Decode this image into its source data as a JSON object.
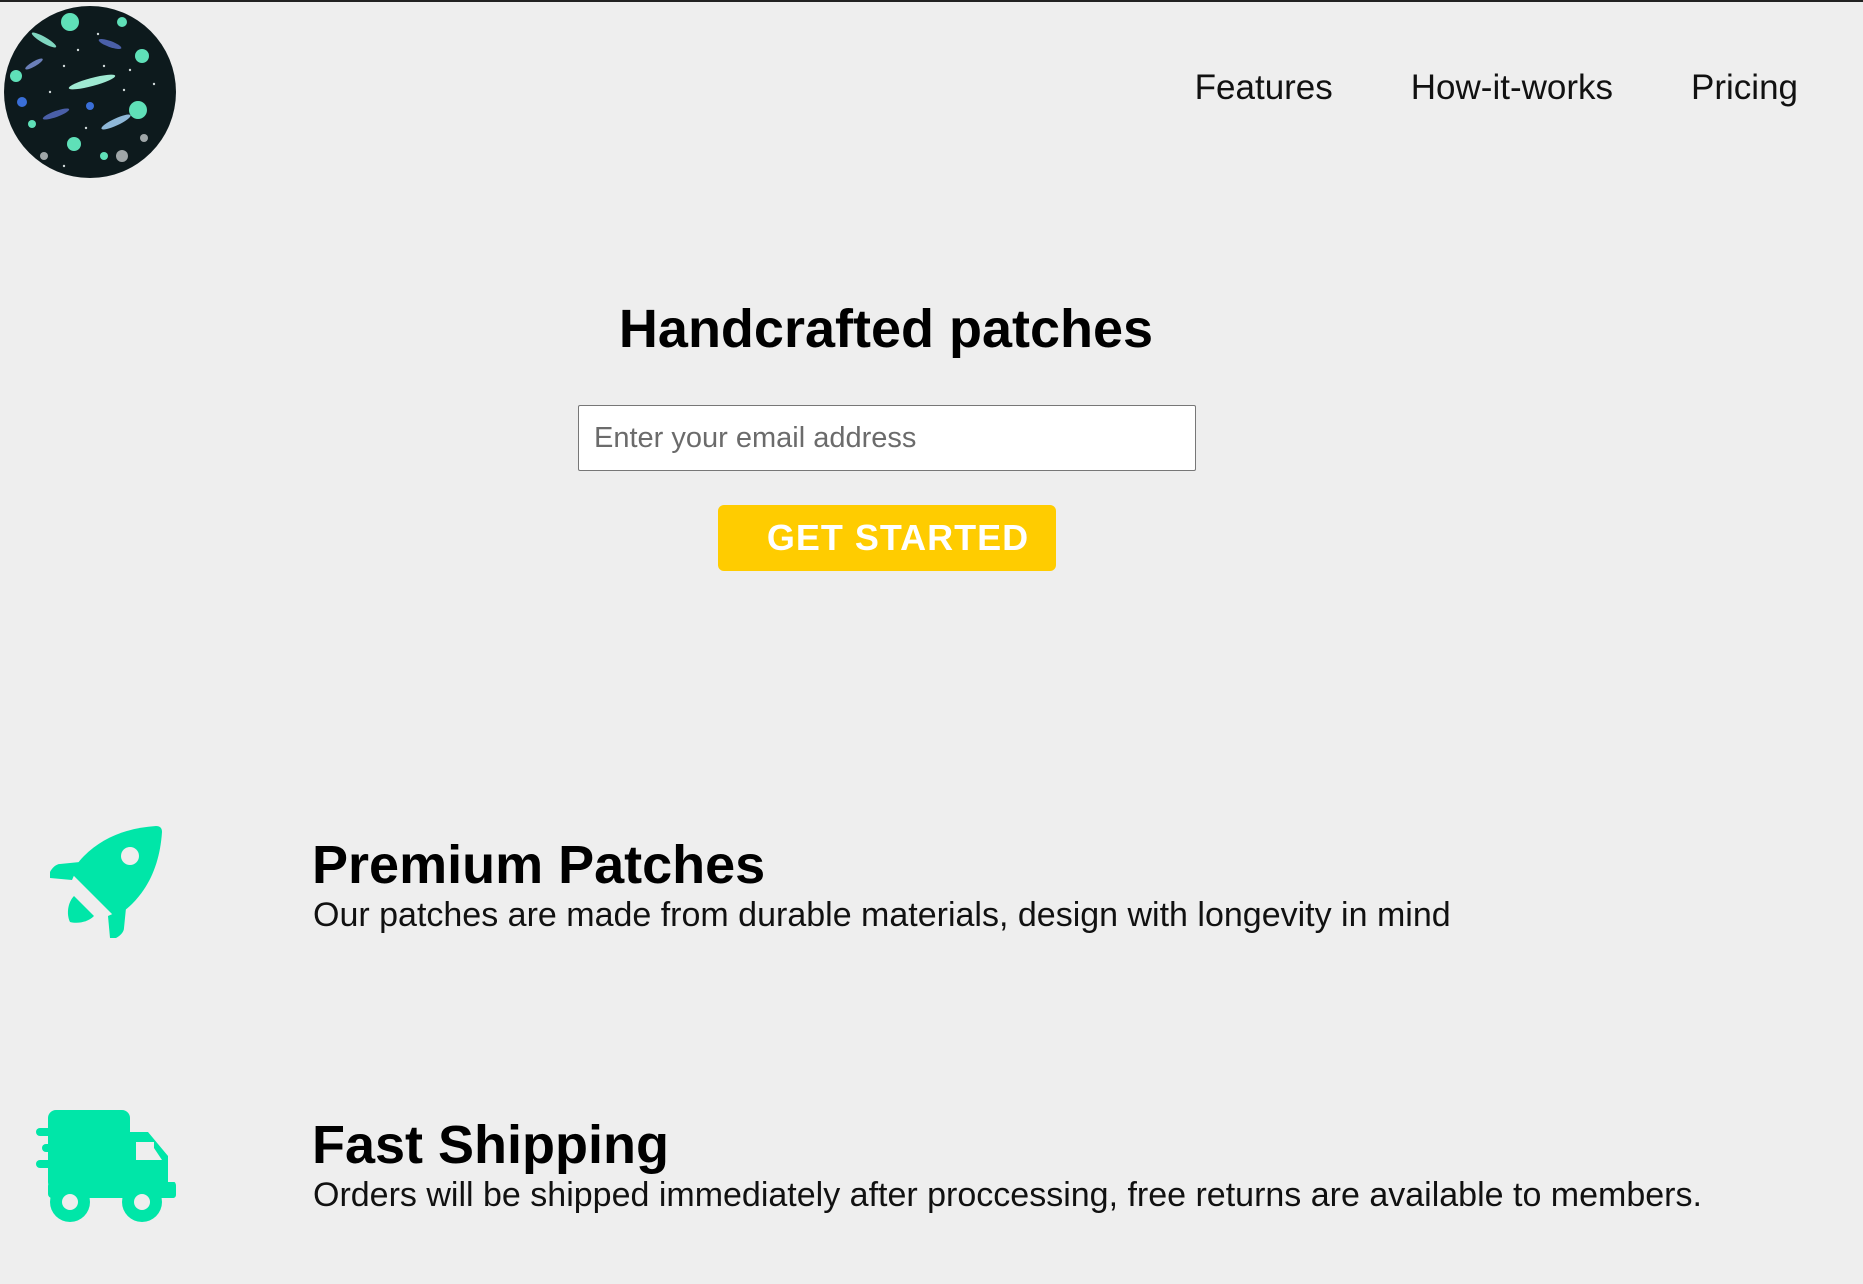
{
  "header": {
    "logo_name": "space-patch-logo",
    "nav": [
      {
        "label": "Features"
      },
      {
        "label": "How-it-works"
      },
      {
        "label": "Pricing"
      }
    ]
  },
  "hero": {
    "title": "Handcrafted patches",
    "email_placeholder": "Enter your email address",
    "cta_label": "GET STARTED",
    "cta_color": "#ffcc00"
  },
  "features": [
    {
      "icon": "rocket-icon",
      "title": "Premium Patches",
      "description": "Our patches are made from durable materials, design with longevity in mind"
    },
    {
      "icon": "shipping-truck-icon",
      "title": "Fast Shipping",
      "description": "Orders will be shipped immediately after proccessing, free returns are available to members."
    }
  ],
  "colors": {
    "background": "#eeeeee",
    "accent": "#00e6a8",
    "button": "#ffcc00"
  }
}
